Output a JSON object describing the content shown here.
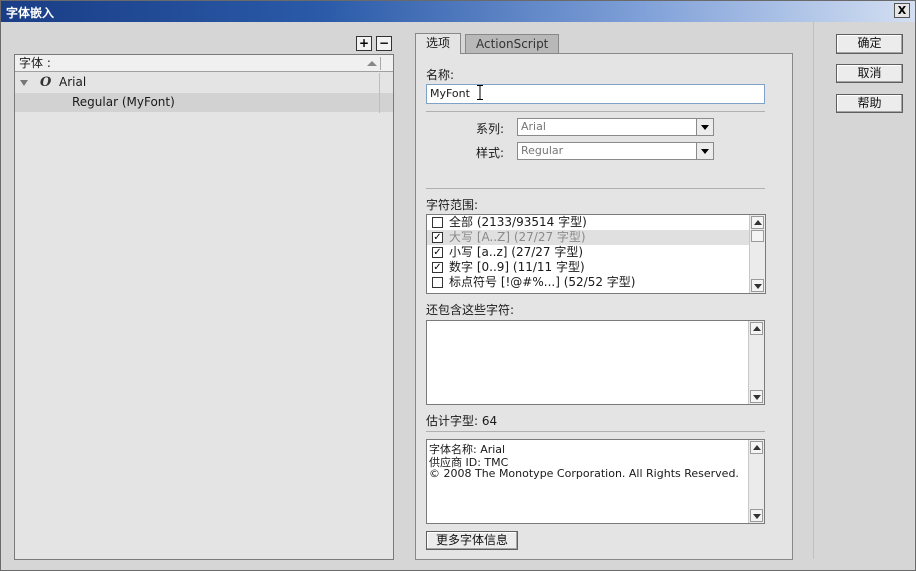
{
  "window": {
    "title": "字体嵌入",
    "close": "X"
  },
  "left_pane": {
    "add": "+",
    "remove": "−",
    "column_header": "字体 :",
    "tree": [
      {
        "name": "Arial",
        "icon": "font-o-icon",
        "glyph": "O"
      },
      {
        "name": "Regular (MyFont)"
      }
    ]
  },
  "tabs": [
    {
      "label": "选项",
      "active": true
    },
    {
      "label": "ActionScript",
      "active": false
    }
  ],
  "options": {
    "name_label": "名称:",
    "name_value": "MyFont",
    "family_label": "系列:",
    "family_value": "Arial",
    "style_label": "样式:",
    "style_value": "Regular",
    "ranges_label": "字符范围:",
    "ranges": [
      {
        "label": "全部  (2133/93514 字型)",
        "checked": false
      },
      {
        "label": "大写 [A..Z]  (27/27 字型)",
        "checked": true
      },
      {
        "label": "小写 [a..z]  (27/27 字型)",
        "checked": true
      },
      {
        "label": "数字 [0..9]  (11/11 字型)",
        "checked": true
      },
      {
        "label": "标点符号 [!@#%...]  (52/52 字型)",
        "checked": false
      }
    ],
    "include_label": "还包含这些字符:",
    "include_value": "",
    "estimate_label": "估计字型: 64",
    "info_lines": [
      "字体名称: Arial",
      "供应商 ID: TMC",
      "© 2008 The Monotype Corporation. All Rights Reserved."
    ],
    "more_button": "更多字体信息"
  },
  "buttons": {
    "ok": "确定",
    "cancel": "取消",
    "help": "帮助"
  },
  "colors": {
    "titlebar_start": "#1a3d86",
    "panel": "#e4e4e4",
    "input_border": "#7fa2c8"
  }
}
